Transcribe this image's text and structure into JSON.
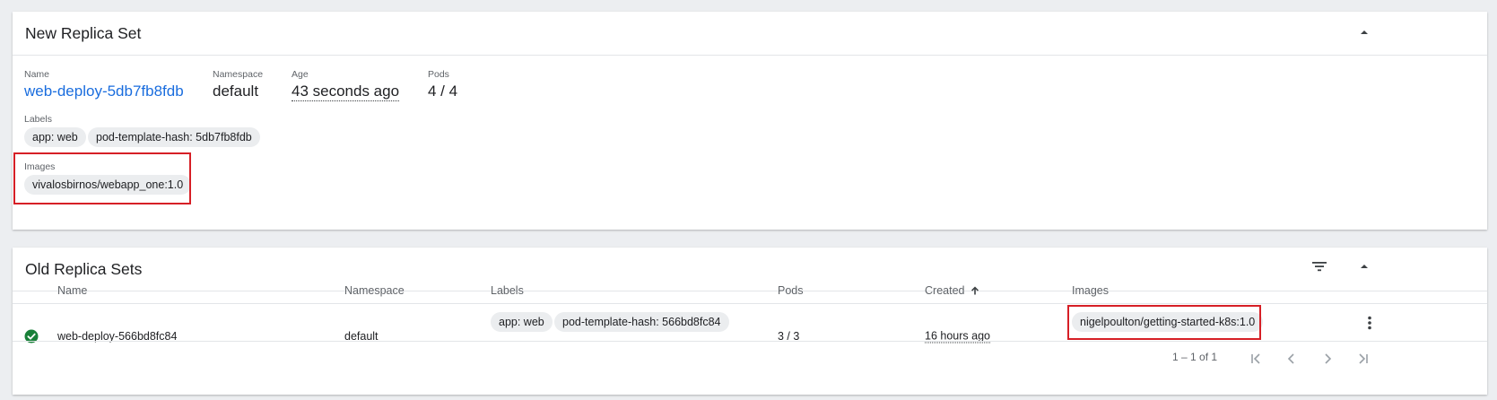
{
  "new_replica_set": {
    "title": "New Replica Set",
    "name_label": "Name",
    "name_value": "web-deploy-5db7fb8fdb",
    "namespace_label": "Namespace",
    "namespace_value": "default",
    "age_label": "Age",
    "age_value": "43 seconds ago",
    "pods_label": "Pods",
    "pods_value": "4 / 4",
    "labels_label": "Labels",
    "labels": [
      "app: web",
      "pod-template-hash: 5db7fb8fdb"
    ],
    "images_label": "Images",
    "images": [
      "vivalosbirnos/webapp_one:1.0"
    ],
    "collapse_icon": "chevron-up-icon"
  },
  "old_replica_sets": {
    "title": "Old Replica Sets",
    "filter_icon": "filter-icon",
    "collapse_icon": "chevron-up-icon",
    "columns": [
      "Name",
      "Namespace",
      "Labels",
      "Pods",
      "Created",
      "Images"
    ],
    "sorted_column": "Created",
    "sort_direction": "ascending",
    "rows": [
      {
        "status": "ok",
        "name": "web-deploy-566bd8fc84",
        "namespace": "default",
        "labels": [
          "app: web",
          "pod-template-hash: 566bd8fc84"
        ],
        "pods": "3 / 3",
        "created": "16 hours ago",
        "image": "nigelpoulton/getting-started-k8s:1.0"
      }
    ],
    "pagination": "1 – 1 of 1"
  },
  "colors": {
    "link": "#1a6dde",
    "status_ok": "#188038",
    "highlight_box": "#d61f26",
    "chip_bg": "#ebedef"
  }
}
